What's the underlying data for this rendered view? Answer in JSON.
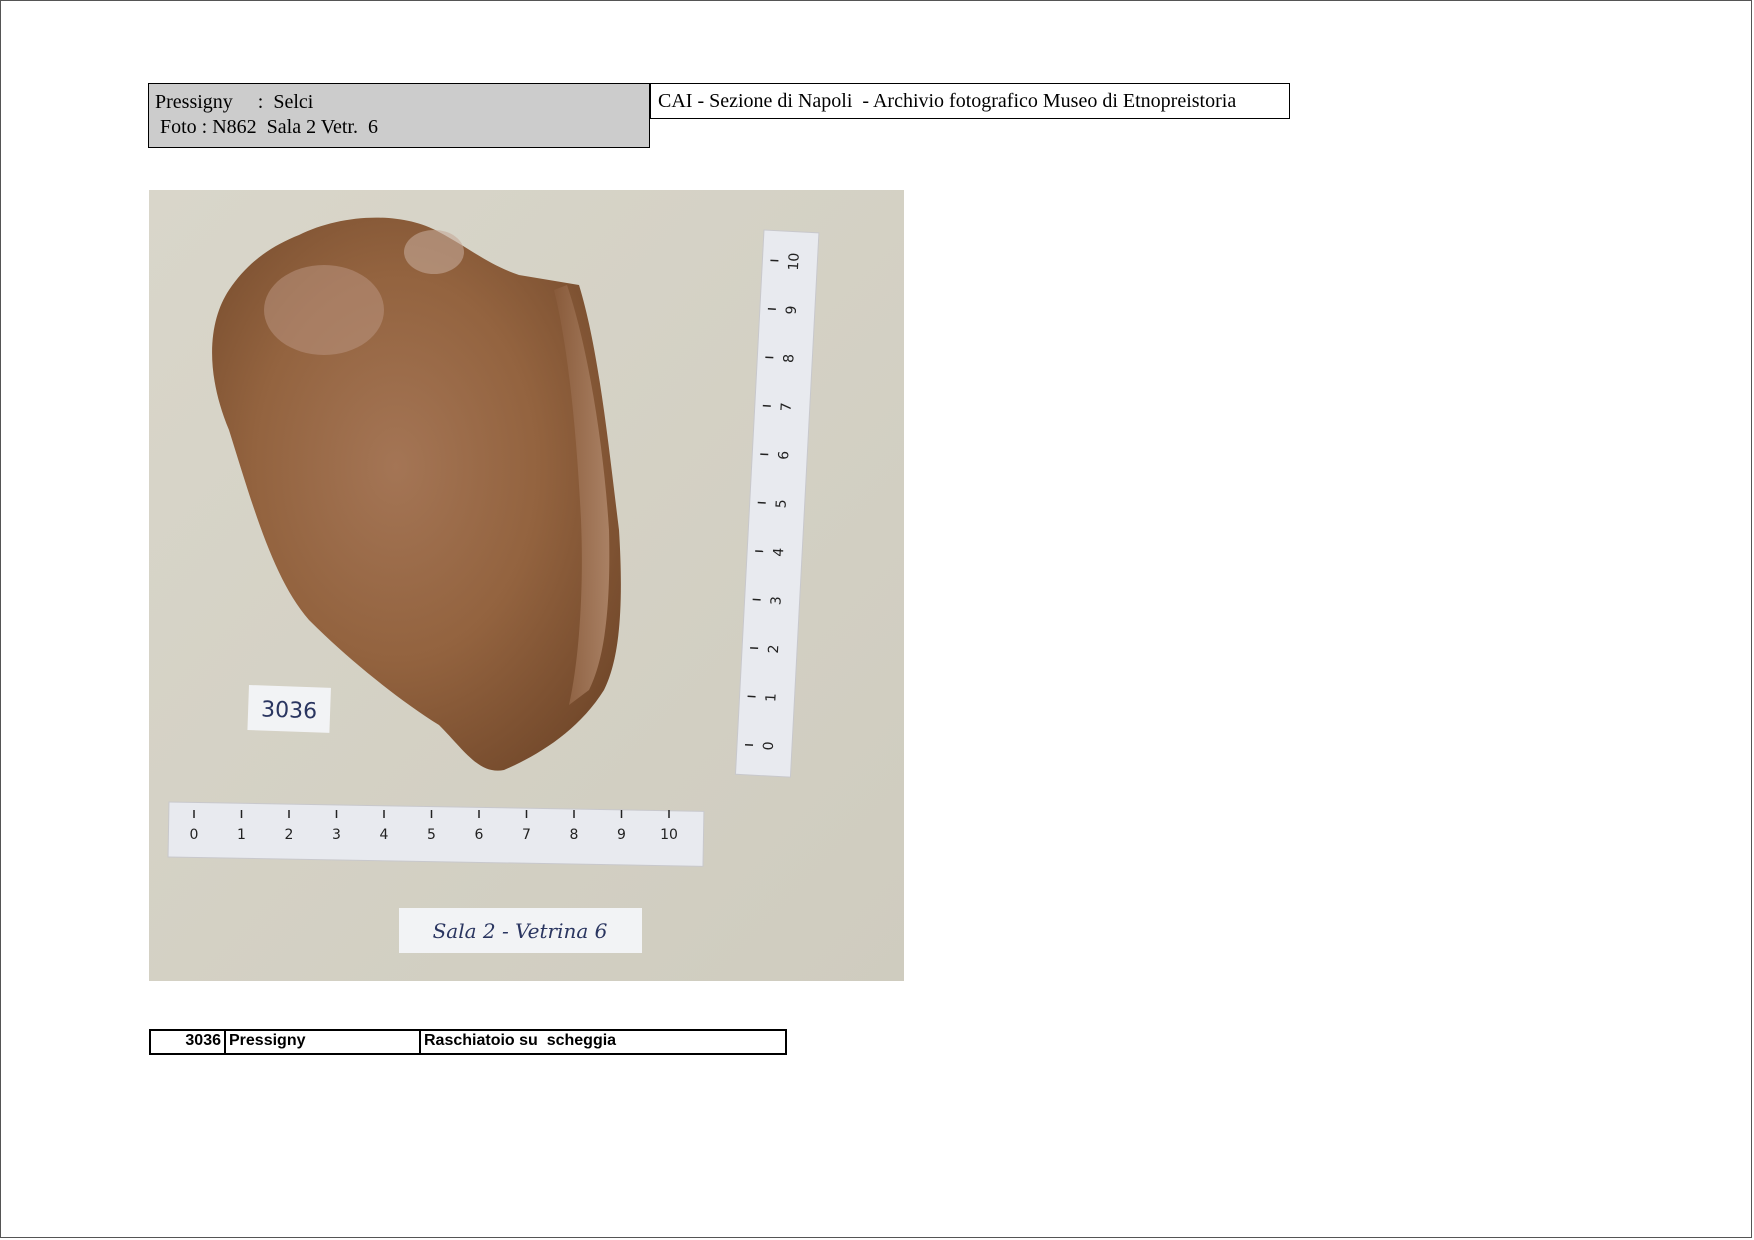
{
  "header": {
    "left_line1": "Pressigny     :  Selci",
    "left_line2": "Foto : N862  Sala 2 Vetr.  6",
    "right_title": "CAI - Sezione di Napoli  - Archivio fotografico Museo di Etnopreistoria"
  },
  "photo": {
    "label_number": "3036",
    "label_location": "Sala 2 - Vetrina 6",
    "ruler_marks": [
      "0",
      "1",
      "2",
      "3",
      "4",
      "5",
      "6",
      "7",
      "8",
      "9",
      "10"
    ],
    "colors": {
      "background": "#d6d3c6",
      "flint": "#9a6a48",
      "label_ink": "#2a3560"
    }
  },
  "catalog": {
    "number": "3036",
    "site": "Pressigny",
    "description": "Raschiatoio su  scheggia"
  }
}
